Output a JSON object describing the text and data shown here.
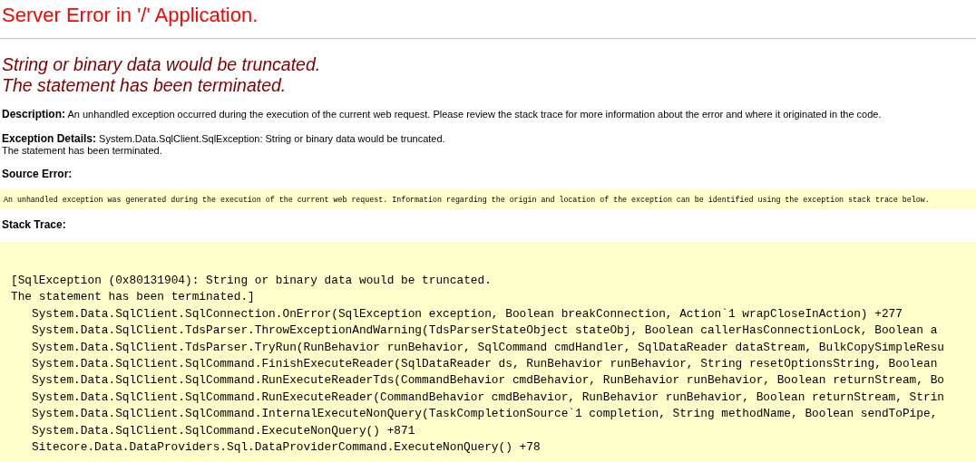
{
  "page_title": "Server Error in '/' Application.",
  "error_message": {
    "lines": [
      "String or binary data would be truncated.",
      "The statement has been terminated."
    ]
  },
  "description": {
    "label": "Description:",
    "text": "An unhandled exception occurred during the execution of the current web request. Please review the stack trace for more information about the error and where it originated in the code."
  },
  "exception_details": {
    "label": "Exception Details:",
    "lines": [
      "System.Data.SqlClient.SqlException: String or binary data would be truncated.",
      "The statement has been terminated."
    ]
  },
  "source_error": {
    "label": "Source Error:",
    "text": "An unhandled exception was generated during the execution of the current web request. Information regarding the origin and location of the exception can be identified using the exception stack trace below."
  },
  "stack_trace": {
    "label": "Stack Trace:",
    "header_lines": [
      "[SqlException (0x80131904): String or binary data would be truncated.",
      "The statement has been terminated.]"
    ],
    "frames": [
      "System.Data.SqlClient.SqlConnection.OnError(SqlException exception, Boolean breakConnection, Action`1 wrapCloseInAction) +277",
      "System.Data.SqlClient.TdsParser.ThrowExceptionAndWarning(TdsParserStateObject stateObj, Boolean callerHasConnectionLock, Boolean a",
      "System.Data.SqlClient.TdsParser.TryRun(RunBehavior runBehavior, SqlCommand cmdHandler, SqlDataReader dataStream, BulkCopySimpleResu",
      "System.Data.SqlClient.SqlCommand.FinishExecuteReader(SqlDataReader ds, RunBehavior runBehavior, String resetOptionsString, Boolean",
      "System.Data.SqlClient.SqlCommand.RunExecuteReaderTds(CommandBehavior cmdBehavior, RunBehavior runBehavior, Boolean returnStream, Bo",
      "System.Data.SqlClient.SqlCommand.RunExecuteReader(CommandBehavior cmdBehavior, RunBehavior runBehavior, Boolean returnStream, Strin",
      "System.Data.SqlClient.SqlCommand.InternalExecuteNonQuery(TaskCompletionSource`1 completion, String methodName, Boolean sendToPipe,",
      "System.Data.SqlClient.SqlCommand.ExecuteNonQuery() +871",
      "Sitecore.Data.DataProviders.Sql.DataProviderCommand.ExecuteNonQuery() +78"
    ]
  }
}
